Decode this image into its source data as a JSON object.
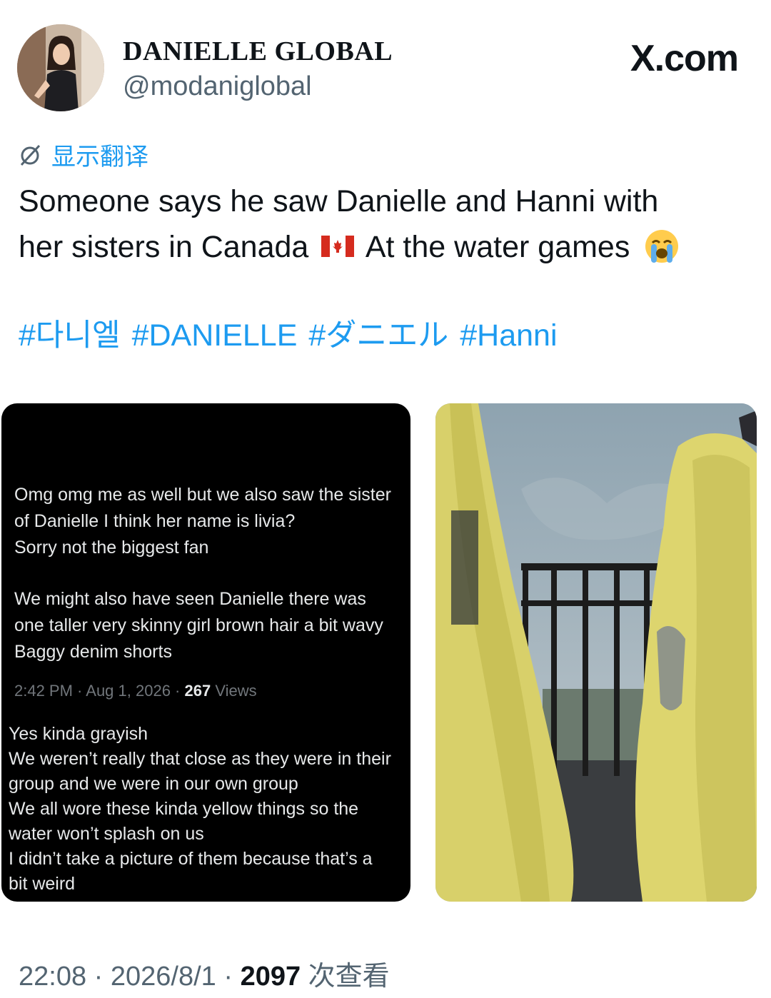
{
  "account": {
    "display_name": "DANIELLE GLOBAL",
    "handle": "@modaniglobal"
  },
  "brand": "X.com",
  "translate_label": "显示翻译",
  "tweet": {
    "line1": "Someone says he saw Danielle and Hanni with",
    "line2_before": "her sisters in Canada",
    "line2_after": "At the water games",
    "hashtags": [
      "#다니엘",
      "#DANIELLE",
      "#ダニエル",
      "#Hanni"
    ]
  },
  "media_screenshot": {
    "para1": [
      "Omg omg me as well but we also saw the sister",
      "of Danielle I think her name is livia?",
      "Sorry not the biggest fan"
    ],
    "para2": [
      "We might also have seen Danielle there was",
      "one taller very skinny girl brown hair a bit wavy",
      "Baggy denim shorts"
    ],
    "meta_time": "2:42 PM · Aug 1, 2026 · ",
    "meta_views_count": "267",
    "meta_views_label": " Views",
    "reply": [
      "Yes kinda grayish",
      "We weren’t really that close as they were in their",
      "group and we were in our own group",
      "We all wore these kinda yellow things so the",
      "water won’t splash on us",
      "I didn’t take a picture of them because that’s a",
      "bit weird"
    ]
  },
  "footer": {
    "time": "22:08 · 2026/8/1 · ",
    "views_count": "2097",
    "views_label": " 次查看"
  }
}
